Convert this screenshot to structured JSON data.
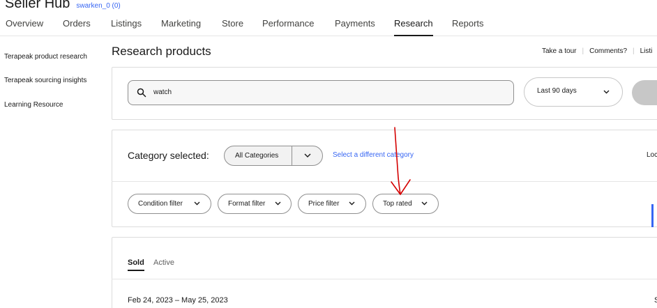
{
  "header": {
    "brand": "Seller Hub",
    "user": "swarken_0 (0)"
  },
  "nav": {
    "items": [
      {
        "label": "Overview"
      },
      {
        "label": "Orders"
      },
      {
        "label": "Listings"
      },
      {
        "label": "Marketing"
      },
      {
        "label": "Store"
      },
      {
        "label": "Performance"
      },
      {
        "label": "Payments"
      },
      {
        "label": "Research",
        "active": true
      },
      {
        "label": "Reports"
      }
    ]
  },
  "sidebar": {
    "items": [
      {
        "label": "Terapeak product research"
      },
      {
        "label": "Terapeak sourcing insights"
      },
      {
        "label": "Learning Resource"
      }
    ]
  },
  "page": {
    "title": "Research products",
    "links": [
      "Take a tour",
      "Comments?",
      "Listi"
    ]
  },
  "search": {
    "value": "watch",
    "date_range": "Last 90 days"
  },
  "category": {
    "label": "Category selected:",
    "selected": "All Categories",
    "change_link": "Select a different category",
    "right_text": "Loc"
  },
  "filters": [
    {
      "label": "Condition filter"
    },
    {
      "label": "Format filter"
    },
    {
      "label": "Price filter"
    },
    {
      "label": "Top rated"
    }
  ],
  "results": {
    "tabs": [
      {
        "label": "Sold",
        "active": true
      },
      {
        "label": "Active"
      }
    ],
    "date_range": "Feb 24, 2023 – May 25, 2023",
    "edge_text": "S"
  },
  "colors": {
    "link": "#3665f3",
    "annotation": "#d40000"
  }
}
